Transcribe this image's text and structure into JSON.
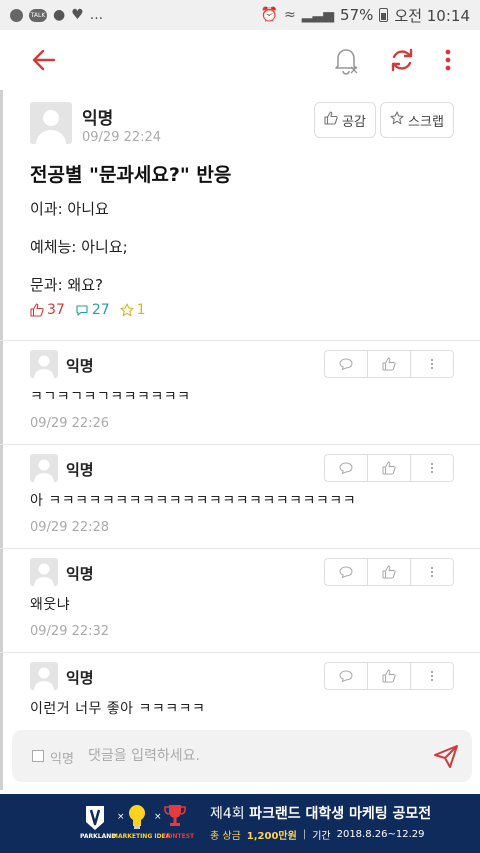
{
  "status_bar": {
    "talk_badge": "TALK",
    "ellipsis": "...",
    "battery": "57%",
    "time_label": "오전 10:14"
  },
  "post": {
    "author": "익명",
    "time": "09/29 22:24",
    "empathy_label": "공감",
    "scrap_label": "스크랩",
    "title": "전공별 \"문과세요?\" 반응",
    "lines": [
      "이과: 아니요",
      "예체능: 아니요;",
      "문과: 왜요?"
    ],
    "stats": {
      "likes": "37",
      "comments": "27",
      "scraps": "1"
    }
  },
  "comments": [
    {
      "author": "익명",
      "body": "ㅋㄱㅋㄱㅋㄱㅋㅋㅋㅋㅋㅋ",
      "time": "09/29 22:26"
    },
    {
      "author": "익명",
      "body": "아 ㅋㅋㅋㅋㅋㅋㅋㅋㅋㅋㅋㅋㅋㅋㅋㅋㅋㅋㅋㅋㅋㅋㅋ",
      "time": "09/29 22:28"
    },
    {
      "author": "익명",
      "body": "왜웃냐",
      "time": "09/29 22:32"
    },
    {
      "author": "익명",
      "body": "이런거 너무 좋아 ㅋㅋㅋㅋㅋ",
      "time": ""
    }
  ],
  "comment_input": {
    "anon_label": "익명",
    "placeholder": "댓글을 입력하세요."
  },
  "ad": {
    "brand1": "PARKLAND",
    "brand2": "MARKETING IDEA",
    "brand3": "CONTEST",
    "title_prefix": "제4회",
    "title_main": "파크랜드 대학생 마케팅 공모전",
    "prize_label": "총 상금",
    "prize_amount": "1,200만원",
    "period_label": "기간",
    "period": "2018.8.26~12.29"
  },
  "colors": {
    "accent": "#d23b3b",
    "comment_count": "#2a9d9a",
    "scrap_count": "#d2b626",
    "ad_bg": "#0f2b5c"
  },
  "icons": [
    "back-arrow-icon",
    "bell-off-icon",
    "refresh-icon",
    "more-vertical-icon",
    "thumbs-up-icon",
    "star-icon",
    "comment-bubble-icon",
    "send-icon"
  ]
}
